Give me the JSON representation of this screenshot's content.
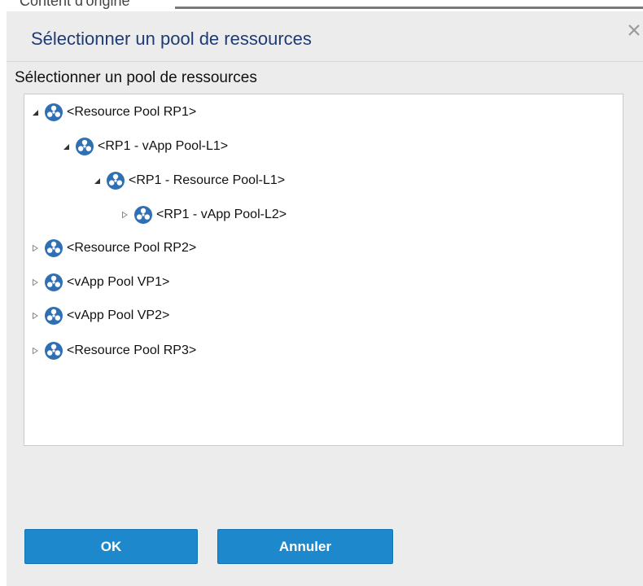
{
  "window": {
    "background_caption": "Content d'origine",
    "title": "Sélectionner un pool de ressources"
  },
  "list_label": "Sélectionner un pool de ressources",
  "tree": [
    {
      "label": "<Resource Pool RP1>",
      "expanded": true,
      "level": 0
    },
    {
      "label": "<RP1 - vApp Pool-L1>",
      "expanded": true,
      "level": 1
    },
    {
      "label": "<RP1 - Resource Pool-L1>",
      "expanded": true,
      "level": 2
    },
    {
      "label": "<RP1 - vApp Pool-L2>",
      "expanded": false,
      "level": 3
    },
    {
      "label": "<Resource Pool RP2>",
      "expanded": false,
      "level": 0
    },
    {
      "label": "<vApp Pool VP1>",
      "expanded": false,
      "level": 0
    },
    {
      "label": "<vApp Pool VP2>",
      "expanded": false,
      "level": 0
    },
    {
      "label": "<Resource Pool RP3>",
      "expanded": false,
      "level": 0
    }
  ],
  "buttons": {
    "ok": "OK",
    "cancel": "Annuler"
  },
  "colors": {
    "title": "#1f3b73",
    "button": "#1e88cc",
    "dialog_bg": "#ececec",
    "icon": "#2f6fb4"
  }
}
